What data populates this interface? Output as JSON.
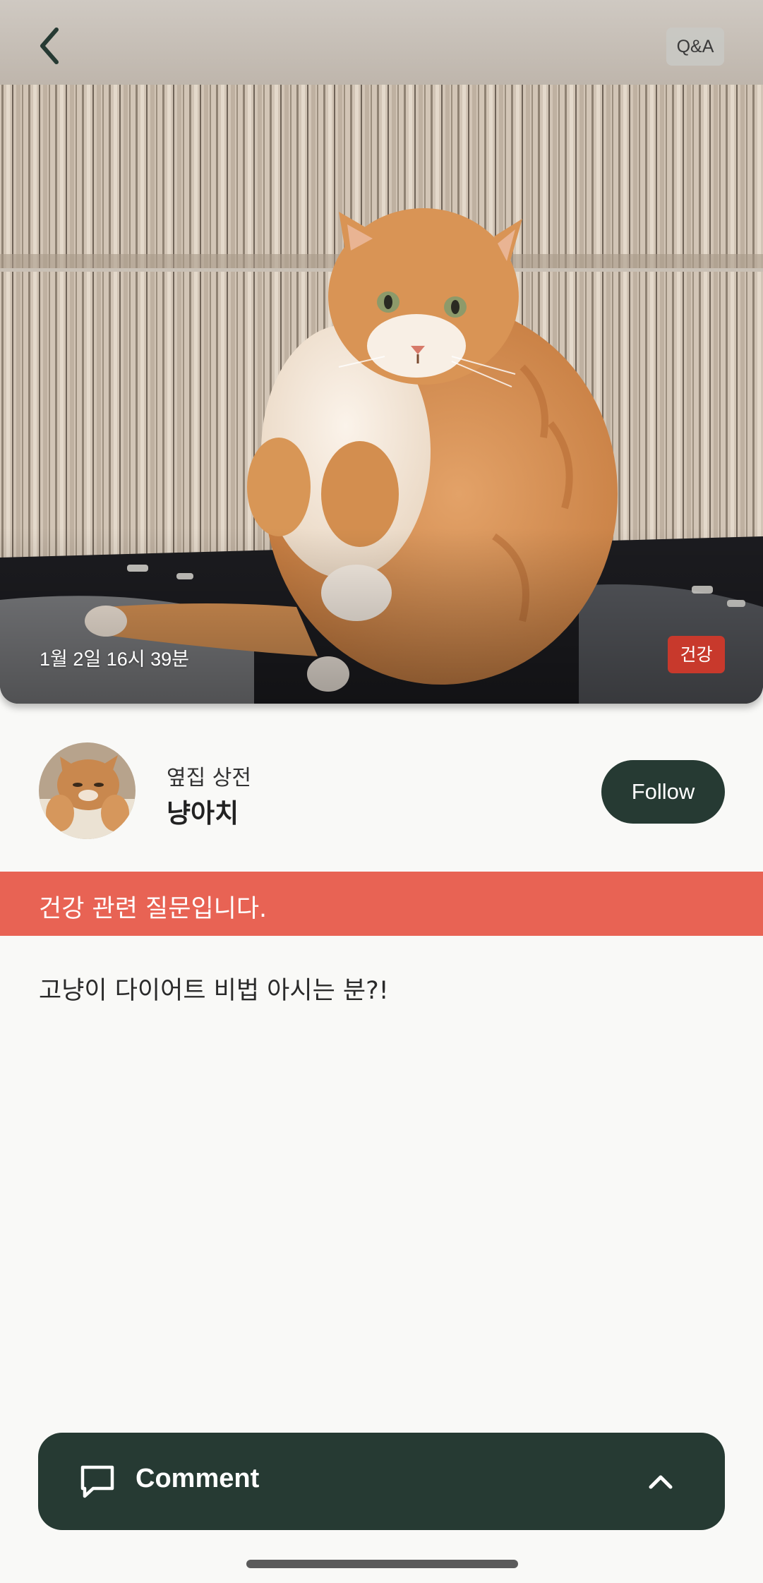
{
  "header": {
    "back_icon": "chevron-left-icon",
    "qa_label": "Q&A"
  },
  "post": {
    "photo": "orange-cat-photo",
    "date": "1월 2일 16시 39분",
    "category_tag": "건강",
    "author": {
      "subtitle": "옆집 상전",
      "name": "냥아치",
      "follow_label": "Follow"
    },
    "question_banner": "건강 관련 질문입니다.",
    "body": "고냥이 다이어트 비법 아시는 분?!"
  },
  "comment_bar": {
    "icon": "comment-bubble-icon",
    "label": "Comment",
    "toggle_icon": "chevron-up-icon"
  },
  "colors": {
    "dark_green": "#263a33",
    "banner_red": "#e86354",
    "tag_red": "#c8392c",
    "background": "#f9f9f7"
  }
}
